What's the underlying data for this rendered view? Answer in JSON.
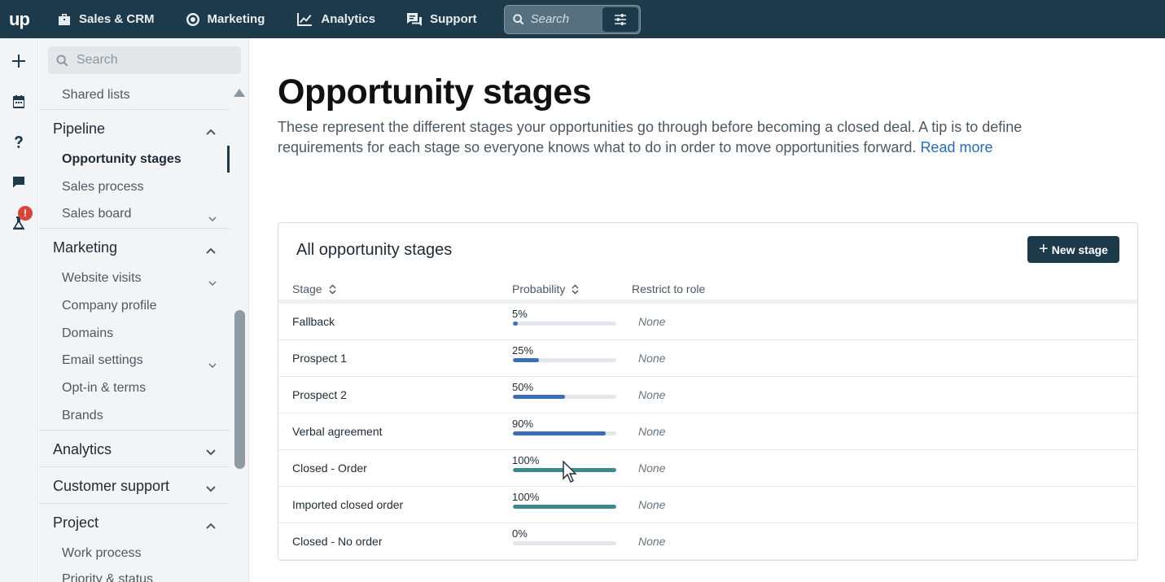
{
  "topbar": {
    "logo": "up",
    "nav": [
      {
        "label": "Sales & CRM",
        "icon": "briefcase-icon"
      },
      {
        "label": "Marketing",
        "icon": "target-icon"
      },
      {
        "label": "Analytics",
        "icon": "chart-line-icon"
      },
      {
        "label": "Support",
        "icon": "chat-bubbles-icon"
      }
    ],
    "search_placeholder": "Search"
  },
  "rail": {
    "icons": [
      "plus-icon",
      "calendar-icon",
      "help-icon",
      "chat-icon",
      "lab-icon"
    ],
    "alert_badge": "!"
  },
  "sidebar": {
    "search_placeholder": "Search",
    "items": {
      "shared_lists": "Shared lists",
      "pipeline": "Pipeline",
      "opportunity_stages": "Opportunity stages",
      "sales_process": "Sales process",
      "sales_board": "Sales board",
      "marketing": "Marketing",
      "website_visits": "Website visits",
      "company_profile": "Company profile",
      "domains": "Domains",
      "email_settings": "Email settings",
      "optin_terms": "Opt-in & terms",
      "brands": "Brands",
      "analytics": "Analytics",
      "customer_support": "Customer support",
      "project": "Project",
      "work_process": "Work process",
      "priority_status": "Priority & status"
    }
  },
  "main": {
    "title": "Opportunity stages",
    "description": "These represent the different stages your opportunities go through before becoming a closed deal. A tip is to define requirements for each stage so everyone knows what to do in order to move opportunities forward.",
    "read_more": "Read more",
    "card": {
      "title": "All opportunity stages",
      "new_button": "New stage",
      "columns": {
        "stage": "Stage",
        "probability": "Probability",
        "restrict": "Restrict to role"
      },
      "rows": [
        {
          "stage": "Fallback",
          "probability": "5%",
          "value": 5,
          "role": "None"
        },
        {
          "stage": "Prospect 1",
          "probability": "25%",
          "value": 25,
          "role": "None"
        },
        {
          "stage": "Prospect 2",
          "probability": "50%",
          "value": 50,
          "role": "None"
        },
        {
          "stage": "Verbal agreement",
          "probability": "90%",
          "value": 90,
          "role": "None"
        },
        {
          "stage": "Closed - Order",
          "probability": "100%",
          "value": 100,
          "role": "None"
        },
        {
          "stage": "Imported closed order",
          "probability": "100%",
          "value": 100,
          "role": "None"
        },
        {
          "stage": "Closed - No order",
          "probability": "0%",
          "value": 0,
          "role": "None"
        }
      ]
    }
  },
  "colors": {
    "topbar": "#1d3a4b",
    "progress_partial": "#3a6fb8",
    "progress_full": "#3a8a8f",
    "link": "#2b6bb5",
    "alert": "#d8453d"
  }
}
